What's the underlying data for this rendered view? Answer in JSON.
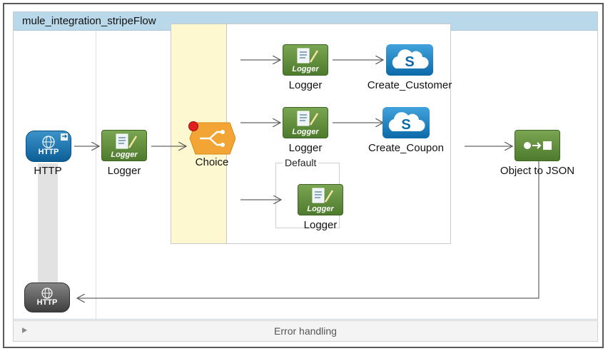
{
  "flow": {
    "title": "mule_integration_stripeFlow"
  },
  "nodes": {
    "http_source": {
      "label": "HTTP",
      "icon_text": "HTTP"
    },
    "logger_main": {
      "label": "Logger",
      "icon_text": "Logger"
    },
    "choice": {
      "label": "Choice"
    },
    "route1_logger": {
      "label": "Logger",
      "icon_text": "Logger"
    },
    "route1_connector": {
      "label": "Create_Customer",
      "icon": "salesforce-cloud-icon"
    },
    "route2_logger": {
      "label": "Logger",
      "icon_text": "Logger"
    },
    "route2_connector": {
      "label": "Create_Coupon",
      "icon": "salesforce-cloud-icon"
    },
    "default_logger": {
      "label": "Logger",
      "icon_text": "Logger"
    },
    "object_to_json": {
      "label": "Object to JSON"
    },
    "http_response": {
      "icon_text": "HTTP"
    }
  },
  "choice_default": {
    "label": "Default"
  },
  "error_handling": {
    "label": "Error handling"
  },
  "colors": {
    "header": "#b9d9ea",
    "logger_green": "#5e8a38",
    "http_blue": "#0b5f96",
    "choice_orange": "#f2a534",
    "choice_lane": "#fdf8cf",
    "breakpoint_red": "#e0201e"
  }
}
